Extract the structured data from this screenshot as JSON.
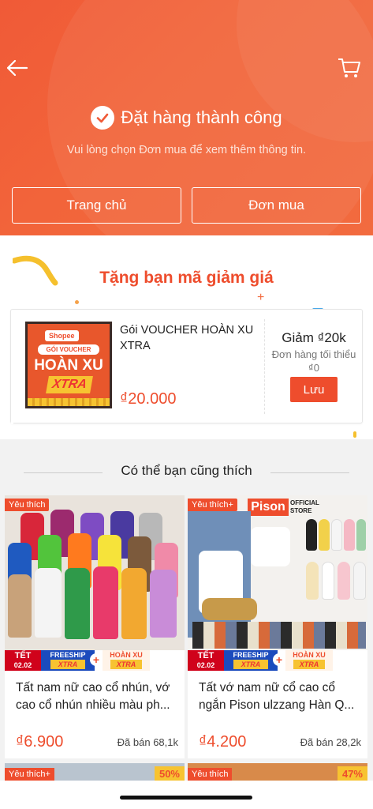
{
  "header": {
    "success_title": "Đặt hàng thành công",
    "subtitle": "Vui lòng chọn Đơn mua để xem thêm thông tin.",
    "home_button": "Trang chủ",
    "orders_button": "Đơn mua",
    "icons": {
      "back": "arrow-left-icon",
      "cart": "cart-icon",
      "check": "check-circle-icon"
    }
  },
  "voucher": {
    "section_title": "Tặng bạn mã giảm giá",
    "image": {
      "brand": "Shopee",
      "line1": "GÓI VOUCHER",
      "line2": "HOÀN XU",
      "line3": "XTRA"
    },
    "name": "Gói VOUCHER HOÀN XU XTRA",
    "price": "₫20.000",
    "discount": "Giảm ₫20k",
    "min_order": "Đơn hàng tối thiểu ₫0",
    "save_button": "Lưu"
  },
  "recommendations": {
    "title": "Có thể bạn cũng thích",
    "products": [
      {
        "tag": "Yêu thích",
        "name": "Tất nam nữ cao cổ nhún, vớ cao cổ nhún nhiều màu ph...",
        "price": "₫6.900",
        "sold": "Đã bán 68,1k",
        "badges": {
          "tet": "TẾT",
          "date": "02.02",
          "freeship": "FREESHIP",
          "xtra": "XTRA",
          "hoanxu": "HOÀN XU"
        }
      },
      {
        "tag": "Yêu thích+",
        "name": "Tất vớ nam nữ cổ cao cổ ngắn Pison ulzzang Hàn Q...",
        "price": "₫4.200",
        "sold": "Đã bán 28,2k",
        "brand": "Pison",
        "brand_sub1": "OFFICIAL",
        "brand_sub2": "STORE",
        "badges": {
          "tet": "TẾT",
          "date": "02.02",
          "freeship": "FREESHIP",
          "xtra": "XTRA",
          "hoanxu": "HOÀN XU"
        }
      }
    ],
    "peek": [
      {
        "tag": "Yêu thích+",
        "discount": "50%"
      },
      {
        "tag": "Yêu thích",
        "discount": "47%"
      }
    ]
  },
  "colors": {
    "accent": "#ee4d2d",
    "header": "#f2643a",
    "background": "#f2f2f2"
  }
}
